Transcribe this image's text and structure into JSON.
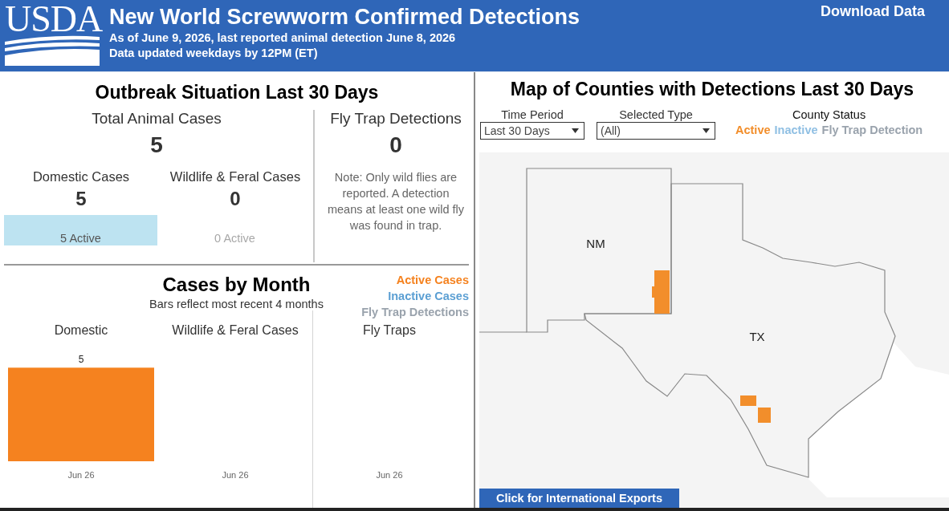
{
  "header": {
    "logo": "USDA",
    "title": "New World Screwworm Confirmed Detections",
    "subtitle_lines": [
      "As of June 9, 2026, last reported animal detection June 8, 2026",
      "Data updated weekdays by 12PM (ET)"
    ],
    "download_link": "Download Data"
  },
  "outbreak": {
    "title": "Outbreak Situation Last 30 Days",
    "total_label": "Total Animal Cases",
    "total_value": "5",
    "breakdown": [
      {
        "label": "Domestic Cases",
        "value": "5",
        "active_label": "5 Active",
        "has_active": true
      },
      {
        "label": "Wildlife & Feral Cases",
        "value": "0",
        "active_label": "0 Active",
        "has_active": false
      }
    ],
    "fly_trap": {
      "label": "Fly Trap Detections",
      "value": "0",
      "note": "Note: Only wild flies are reported. A detection means at least one wild fly was found in trap."
    }
  },
  "cases_by_month": {
    "title": "Cases by Month",
    "subtitle": "Bars reflect most recent 4 months",
    "legend": [
      {
        "label": "Active Cases",
        "color": "#f5821f"
      },
      {
        "label": "Inactive Cases",
        "color": "#5b9fd3"
      },
      {
        "label": "Fly Trap Detections",
        "color": "#9aa3ad"
      }
    ],
    "panels": [
      {
        "title": "Domestic",
        "month_label": "Jun 26",
        "bar_value": "5"
      },
      {
        "title": "Wildlife & Feral Cases",
        "month_label": "Jun 26"
      },
      {
        "title": "Fly Traps",
        "month_label": "Jun 26"
      }
    ]
  },
  "map": {
    "title": "Map of Counties with Detections Last 30 Days",
    "filters": [
      {
        "label": "Time Period",
        "value": "Last 30 Days"
      },
      {
        "label": "Selected Type",
        "value": "(All)"
      }
    ],
    "county_status": {
      "title": "County Status",
      "items": [
        {
          "label": "Active",
          "color": "#f28e2b"
        },
        {
          "label": "Inactive",
          "color": "#8fbfe3"
        },
        {
          "label": "Fly Trap Detection",
          "color": "#9aa3ad"
        }
      ]
    },
    "state_labels": [
      "NM",
      "TX"
    ],
    "counties": [
      {
        "color": "#f28e2b"
      },
      {
        "color": "#f28e2b"
      },
      {
        "color": "#f28e2b"
      }
    ],
    "export_button": "Click for International Exports"
  }
}
